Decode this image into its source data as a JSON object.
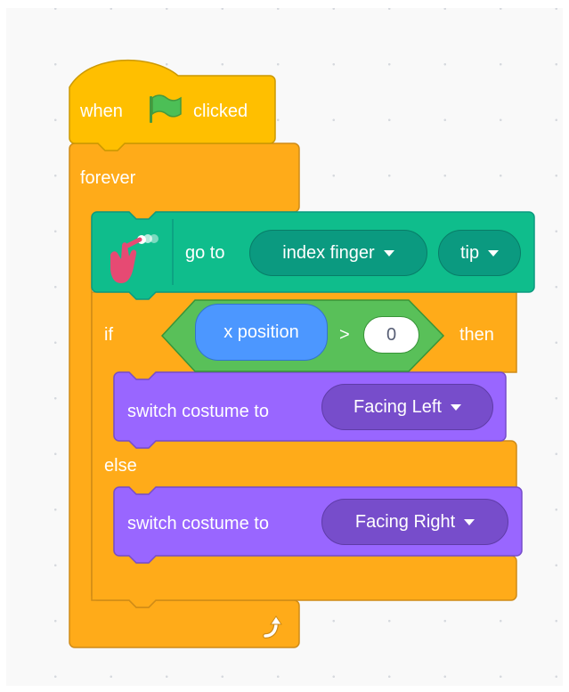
{
  "colors": {
    "events": "#ffbf00",
    "control": "#ffab19",
    "extension": "#0fbd8c",
    "operators": "#59c059",
    "sensing_reporter": "#4c97ff",
    "looks": "#9966ff"
  },
  "script": {
    "hat": {
      "when_label": "when",
      "flag_icon": "green-flag-icon",
      "clicked_label": "clicked"
    },
    "forever": {
      "label": "forever",
      "loop_icon": "loop-arrow-icon"
    },
    "goto_block": {
      "extension_icon": "hand-pose-icon",
      "label": "go to",
      "part_dropdown": "index finger",
      "point_dropdown": "tip"
    },
    "if_else": {
      "if_label": "if",
      "then_label": "then",
      "else_label": "else",
      "condition": {
        "left_reporter": "x position",
        "operator": ">",
        "right_value": "0"
      }
    },
    "switch_left": {
      "label": "switch costume to",
      "costume": "Facing Left"
    },
    "switch_right": {
      "label": "switch costume to",
      "costume": "Facing Right"
    }
  }
}
